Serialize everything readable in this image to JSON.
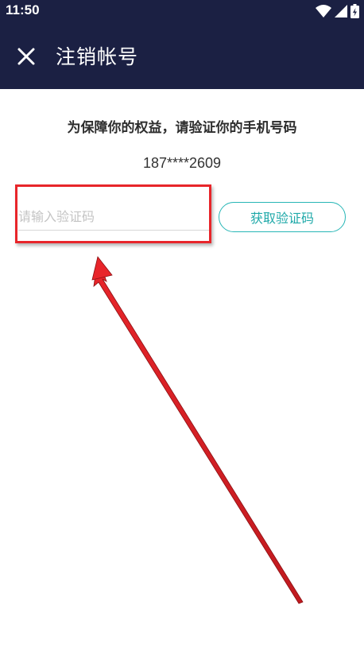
{
  "status_bar": {
    "time": "11:50",
    "icons": [
      "wifi-icon",
      "signal-icon",
      "battery-icon"
    ]
  },
  "header": {
    "close_icon": "close-icon",
    "title": "注销帐号",
    "background": "#1b2043"
  },
  "main": {
    "notice": "为保障你的权益，请验证你的手机号码",
    "phone": "187****2609",
    "code_input": {
      "placeholder": "请输入验证码",
      "value": ""
    },
    "get_code_button": "获取验证码"
  },
  "annotation": {
    "highlight_color": "#e8252a",
    "pointer": "arrow"
  },
  "colors": {
    "accent": "#27b6b6",
    "text": "#2d2d2d"
  }
}
